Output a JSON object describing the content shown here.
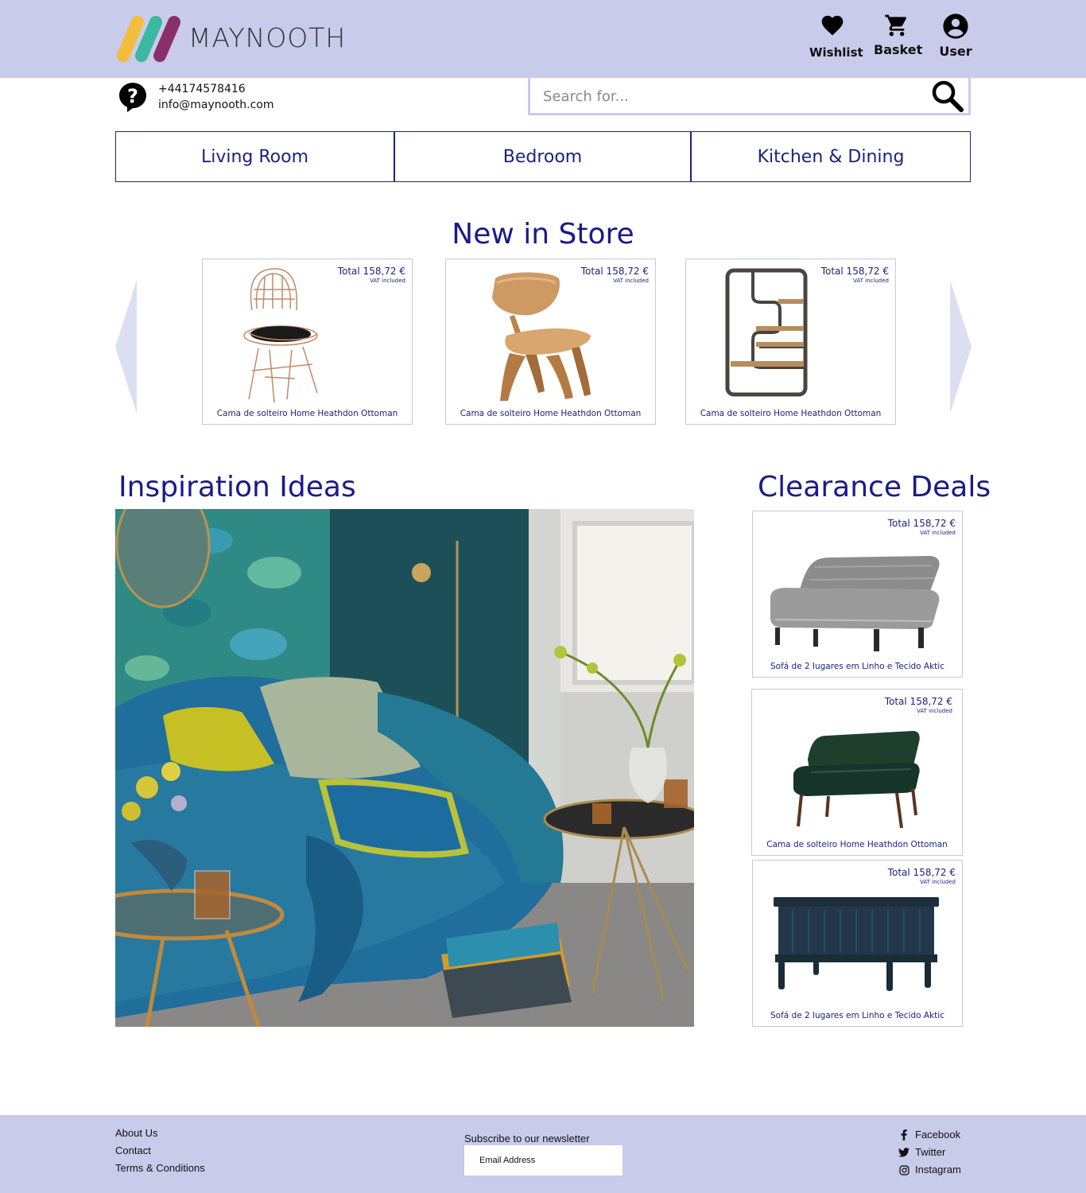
{
  "brand": {
    "name": "MAYNOOTH"
  },
  "header_actions": [
    {
      "label": "Wishlist",
      "icon": "heart-icon"
    },
    {
      "label": "Basket",
      "icon": "cart-icon"
    },
    {
      "label": "User",
      "icon": "user-icon"
    }
  ],
  "contact": {
    "phone": "+44174578416",
    "email": "info@maynooth.com",
    "icon": "help-chat-icon"
  },
  "search": {
    "placeholder": "Search for...",
    "value": ""
  },
  "nav": [
    {
      "label": "Living Room"
    },
    {
      "label": "Bedroom"
    },
    {
      "label": "Kitchen & Dining"
    }
  ],
  "new_in_store": {
    "title": "New in Store",
    "products": [
      {
        "price": "Total 158,72 €",
        "vat": "VAT included",
        "name": "Cama de solteiro Home Heathdon Ottoman"
      },
      {
        "price": "Total 158,72 €",
        "vat": "VAT included",
        "name": "Cama de solteiro Home Heathdon Ottoman"
      },
      {
        "price": "Total 158,72 €",
        "vat": "VAT included",
        "name": "Cama de solteiro Home Heathdon Ottoman"
      }
    ]
  },
  "inspiration": {
    "title": "Inspiration Ideas"
  },
  "clearance": {
    "title": "Clearance Deals",
    "products": [
      {
        "price": "Total 158,72 €",
        "vat": "VAT included",
        "name": "Sofá de 2 lugares em Linho e Tecido Aktic"
      },
      {
        "price": "Total 158,72 €",
        "vat": "VAT included",
        "name": "Cama de solteiro Home Heathdon Ottoman"
      },
      {
        "price": "Total 158,72 €",
        "vat": "VAT included",
        "name": "Sofá de 2 lugares em Linho e Tecido Aktic"
      }
    ]
  },
  "footer": {
    "links": [
      "About Us",
      "Contact",
      "Terms & Conditions"
    ],
    "newsletter_label": "Subscribe to our newsletter",
    "email_placeholder": "Email Address",
    "social": [
      {
        "label": "Facebook",
        "icon": "facebook-icon"
      },
      {
        "label": "Twitter",
        "icon": "twitter-icon"
      },
      {
        "label": "Instagram",
        "icon": "instagram-icon"
      }
    ]
  },
  "colors": {
    "header_bg": "#c8cbea",
    "accent": "#1a237e",
    "title": "#1a1a8c"
  }
}
